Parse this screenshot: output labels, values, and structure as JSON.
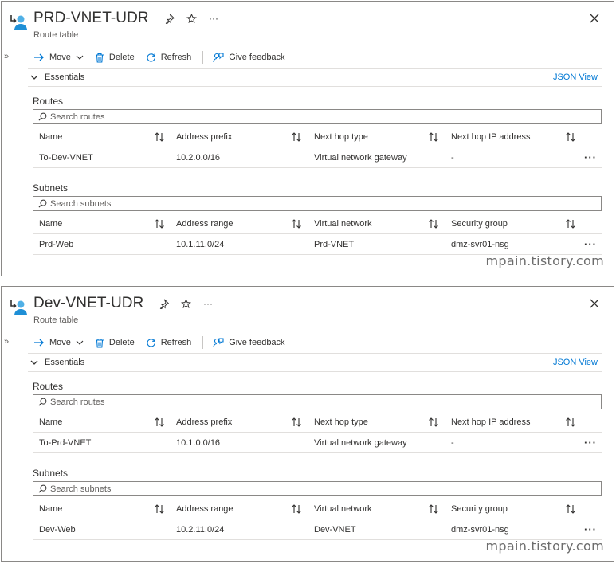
{
  "panels": [
    {
      "title": "PRD-VNET-UDR",
      "subtitle": "Route table",
      "toolbar": {
        "move": "Move",
        "delete": "Delete",
        "refresh": "Refresh",
        "feedback": "Give feedback"
      },
      "essentials": "Essentials",
      "json_view": "JSON View",
      "routes": {
        "label": "Routes",
        "search_placeholder": "Search routes",
        "columns": [
          "Name",
          "Address prefix",
          "Next hop type",
          "Next hop IP address"
        ],
        "rows": [
          [
            "To-Dev-VNET",
            "10.2.0.0/16",
            "Virtual network gateway",
            "-"
          ]
        ]
      },
      "subnets": {
        "label": "Subnets",
        "search_placeholder": "Search subnets",
        "columns": [
          "Name",
          "Address range",
          "Virtual network",
          "Security group"
        ],
        "rows": [
          [
            "Prd-Web",
            "10.1.11.0/24",
            "Prd-VNET",
            "dmz-svr01-nsg"
          ]
        ]
      },
      "watermark": "mpain.tistory.com"
    },
    {
      "title": "Dev-VNET-UDR",
      "subtitle": "Route table",
      "toolbar": {
        "move": "Move",
        "delete": "Delete",
        "refresh": "Refresh",
        "feedback": "Give feedback"
      },
      "essentials": "Essentials",
      "json_view": "JSON View",
      "routes": {
        "label": "Routes",
        "search_placeholder": "Search routes",
        "columns": [
          "Name",
          "Address prefix",
          "Next hop type",
          "Next hop IP address"
        ],
        "rows": [
          [
            "To-Prd-VNET",
            "10.1.0.0/16",
            "Virtual network gateway",
            "-"
          ]
        ]
      },
      "subnets": {
        "label": "Subnets",
        "search_placeholder": "Search subnets",
        "columns": [
          "Name",
          "Address range",
          "Virtual network",
          "Security group"
        ],
        "rows": [
          [
            "Dev-Web",
            "10.2.11.0/24",
            "Dev-VNET",
            "dmz-svr01-nsg"
          ]
        ]
      },
      "watermark": "mpain.tistory.com"
    }
  ],
  "icons": {
    "route_table": "route-table-icon",
    "pin": "pin-icon",
    "star": "star-icon",
    "more": "more-icon",
    "close": "close-icon",
    "move": "arrow-right-icon",
    "delete": "trash-icon",
    "refresh": "refresh-icon",
    "feedback": "feedback-icon",
    "sort": "sort-icon",
    "search": "search-icon"
  },
  "colors": {
    "accent": "#0078d4",
    "border": "#8a8886",
    "divider": "#e1dfdd",
    "text": "#323130"
  }
}
